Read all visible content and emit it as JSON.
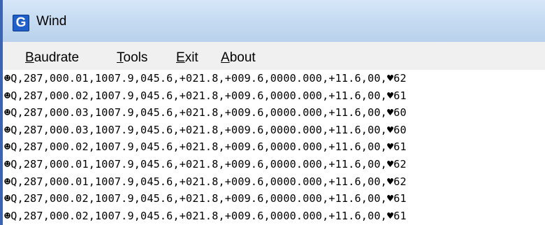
{
  "window": {
    "title": "Wind",
    "icon_letter": "G"
  },
  "menu": [
    {
      "mnemonic": "B",
      "rest": "audrate"
    },
    {
      "mnemonic": "T",
      "rest": "ools"
    },
    {
      "mnemonic": "E",
      "rest": "xit"
    },
    {
      "mnemonic": "A",
      "rest": "bout"
    }
  ],
  "serial_output": [
    "☻Q,287,000.01,1007.9,045.6,+021.8,+009.6,0000.000,+11.6,00,♥62",
    "☻Q,287,000.02,1007.9,045.6,+021.8,+009.6,0000.000,+11.6,00,♥61",
    "☻Q,287,000.03,1007.9,045.6,+021.8,+009.6,0000.000,+11.6,00,♥60",
    "☻Q,287,000.03,1007.9,045.6,+021.8,+009.6,0000.000,+11.6,00,♥60",
    "☻Q,287,000.02,1007.9,045.6,+021.8,+009.6,0000.000,+11.6,00,♥61",
    "☻Q,287,000.01,1007.9,045.6,+021.8,+009.6,0000.000,+11.6,00,♥62",
    "☻Q,287,000.01,1007.9,045.6,+021.8,+009.6,0000.000,+11.6,00,♥62",
    "☻Q,287,000.02,1007.9,045.6,+021.8,+009.6,0000.000,+11.6,00,♥61",
    "☻Q,287,000.02,1007.9,045.6,+021.8,+009.6,0000.000,+11.6,00,♥61"
  ]
}
